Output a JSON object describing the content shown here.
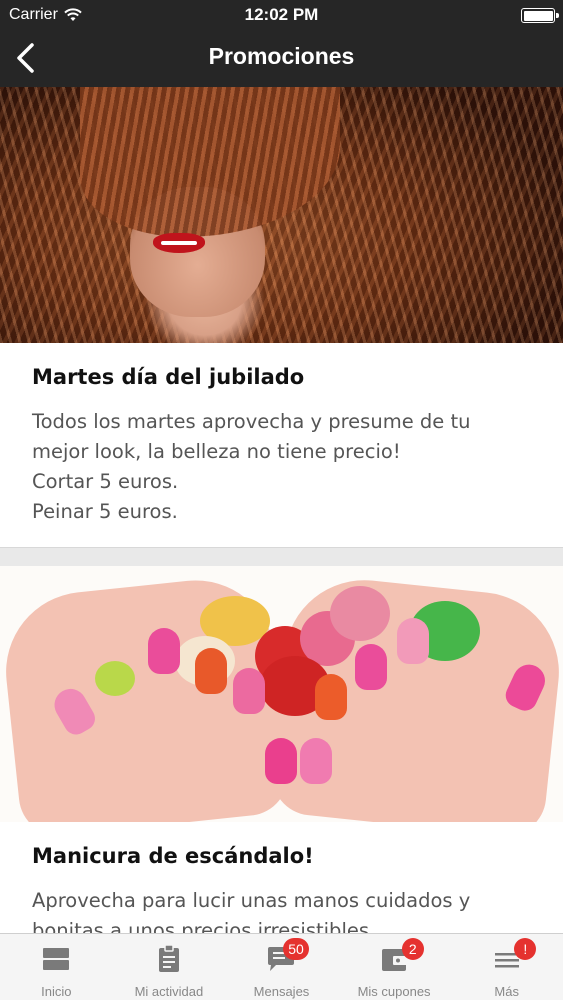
{
  "status_bar": {
    "carrier": "Carrier",
    "time": "12:02 PM"
  },
  "nav": {
    "title": "Promociones"
  },
  "promotions": [
    {
      "title": "Martes día del jubilado",
      "lines": [
        "Todos los martes aprovecha y presume de tu",
        "mejor look, la belleza no tiene precio!",
        "Cortar 5 euros.",
        "Peinar 5 euros."
      ]
    },
    {
      "title": "Manicura de escándalo!",
      "lines": [
        "Aprovecha para lucir unas manos cuidados y",
        "bonitas a unos precios irresistibles"
      ]
    }
  ],
  "tabs": [
    {
      "label": "Inicio",
      "icon": "home-icon"
    },
    {
      "label": "Mi actividad",
      "icon": "clipboard-icon"
    },
    {
      "label": "Mensajes",
      "icon": "chat-icon",
      "badge": "50"
    },
    {
      "label": "Mis cupones",
      "icon": "wallet-icon",
      "badge": "2"
    },
    {
      "label": "Más",
      "icon": "menu-icon",
      "badge": "!"
    }
  ],
  "colors": {
    "bar": "#262626",
    "badge": "#e5322f",
    "tab_icon": "#7a7a7a"
  }
}
